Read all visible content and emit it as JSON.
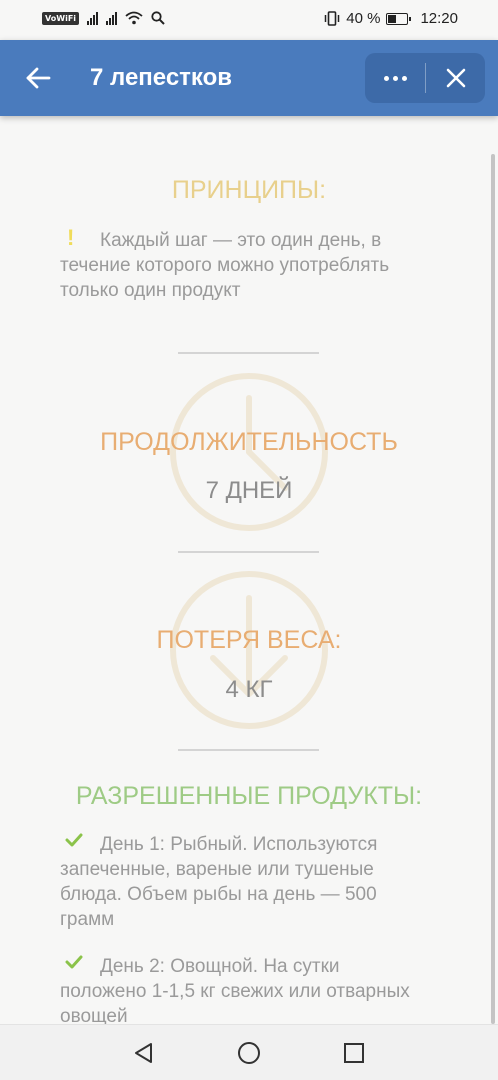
{
  "status_bar": {
    "vowifi": "VoWiFi",
    "battery_percent": "40 %",
    "time": "12:20"
  },
  "app_bar": {
    "title": "7 лепестков",
    "background": "#4a7bbd"
  },
  "principles": {
    "title": "ПРИНЦИПЫ:",
    "text": "Каждый шаг — это один день, в течение которого можно употреблять только один продукт",
    "title_color": "#e8d08c"
  },
  "duration": {
    "title": "ПРОДОЛЖИТЕЛЬНОСТЬ",
    "value": "7 ДНЕЙ",
    "title_color": "#e8ad72"
  },
  "weight_loss": {
    "title": "ПОТЕРЯ ВЕСА:",
    "value": "4 КГ"
  },
  "allowed_products": {
    "title": "РАЗРЕШЕННЫЕ ПРОДУКТЫ:",
    "title_color": "#9ecb85",
    "items": [
      {
        "text": "День 1: Рыбный. Используются запеченные, вареные или тушеные блюда. Объем рыбы на день — 500 грамм"
      },
      {
        "text": "День 2: Овощной. На сутки положено 1-1,5 кг свежих или отварных овощей"
      }
    ]
  },
  "icons": {
    "back": "arrow-left-icon",
    "more": "more-dots-icon",
    "close": "close-icon",
    "principle_bullet": "exclamation-icon",
    "allowed_bullet": "check-icon",
    "duration_bg": "clock-icon",
    "weight_bg": "arrow-down-circle-icon"
  },
  "accent_check_color": "#8bc34a"
}
